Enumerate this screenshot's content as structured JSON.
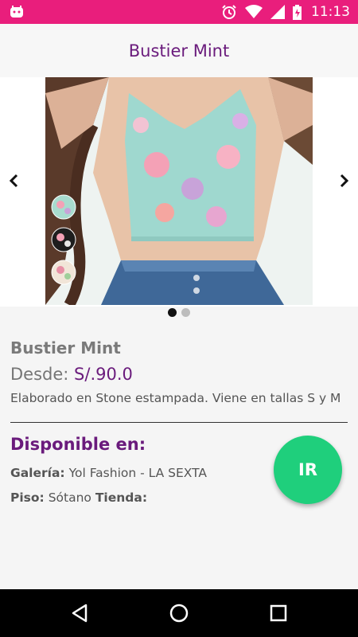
{
  "status_bar": {
    "time": "11:13",
    "icons": [
      "android-icon",
      "alarm-icon",
      "wifi-icon",
      "signal-icon",
      "battery-icon"
    ]
  },
  "header": {
    "title": "Bustier Mint"
  },
  "carousel": {
    "image_alt": "Bustier Mint",
    "dot_count": 2,
    "active_index": 0
  },
  "product": {
    "name": "Bustier Mint",
    "price_label": "Desde:",
    "price": "S/.90.0",
    "description": "Elaborado en Stone estampada. Viene en tallas S y M"
  },
  "availability": {
    "title": "Disponible en:",
    "galeria_label": "Galería:",
    "galeria_value": "Yol Fashion - LA SEXTA",
    "piso_label": "Piso:",
    "piso_value": "Sótano",
    "tienda_label": "Tienda:",
    "tienda_value": ""
  },
  "actions": {
    "ir_label": "IR"
  },
  "colors": {
    "status_bar": "#e91e7c",
    "accent_purple": "#6a1b7c",
    "ir_button": "#1fcf7c"
  }
}
